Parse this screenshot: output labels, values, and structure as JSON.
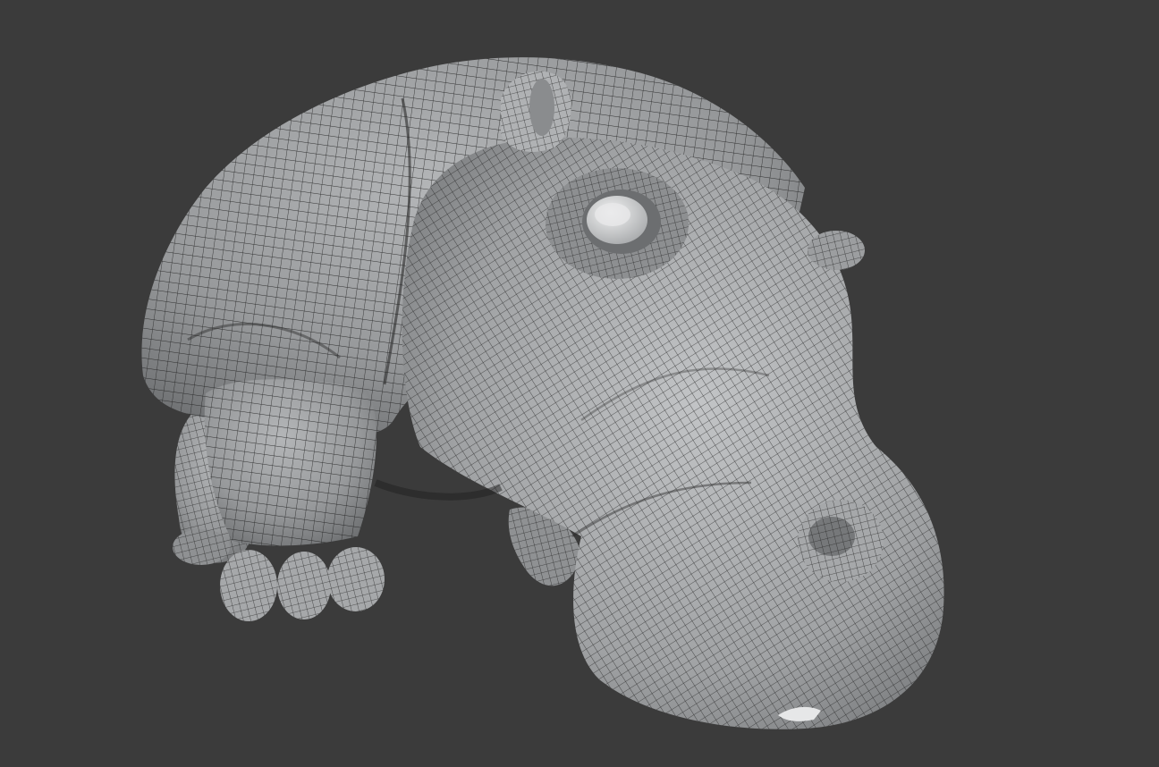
{
  "viewport": {
    "background_color": "#3b3b3b",
    "display_mode": "shaded-wireframe",
    "subject": "hippo-model"
  },
  "model": {
    "shading_color": "#9a9c9e",
    "wire_color": "#1f1f1f",
    "highlight_color": "#d6d8d9",
    "shadow_color": "#4c4d4f"
  }
}
